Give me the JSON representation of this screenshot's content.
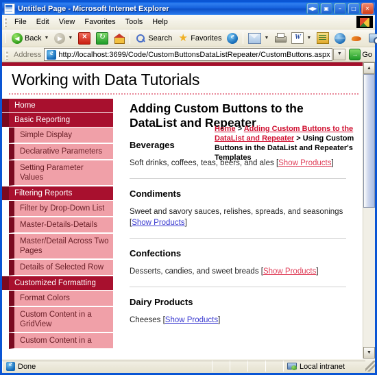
{
  "window": {
    "title": "Untitled Page - Microsoft Internet Explorer",
    "buttons": {
      "restore_group": "◀▶",
      "group2": "▣",
      "minimize": "–",
      "maximize": "□",
      "close": "✕"
    }
  },
  "menu": {
    "items": [
      {
        "label": "File"
      },
      {
        "label": "Edit"
      },
      {
        "label": "View"
      },
      {
        "label": "Favorites"
      },
      {
        "label": "Tools"
      },
      {
        "label": "Help"
      }
    ]
  },
  "toolbar": {
    "back_label": "Back",
    "forward_label": "",
    "search_label": "Search",
    "favorites_label": "Favorites",
    "caret": "▼"
  },
  "address": {
    "label": "Address",
    "url": "http://localhost:3699/Code/CustomButtonsDataListRepeater/CustomButtons.aspx",
    "dropdown": "▼",
    "go_label": "Go",
    "go_glyph": "→"
  },
  "site": {
    "title": "Working with Data Tutorials"
  },
  "breadcrumb": {
    "home": "Home",
    "sep1": " > ",
    "parent": "Adding Custom Buttons to the DataList and Repeater",
    "sep2": " > ",
    "current": "Using Custom Buttons in the DataList and Repeater's Templates"
  },
  "sidebar": {
    "items": [
      {
        "label": "Home",
        "type": "head"
      },
      {
        "label": "Basic Reporting",
        "type": "head"
      },
      {
        "label": "Simple Display",
        "type": "sub"
      },
      {
        "label": "Declarative Parameters",
        "type": "sub"
      },
      {
        "label": "Setting Parameter Values",
        "type": "sub"
      },
      {
        "label": "Filtering Reports",
        "type": "head"
      },
      {
        "label": "Filter by Drop-Down List",
        "type": "sub"
      },
      {
        "label": "Master-Details-Details",
        "type": "sub"
      },
      {
        "label": "Master/Detail Across Two Pages",
        "type": "sub"
      },
      {
        "label": "Details of Selected Row",
        "type": "sub"
      },
      {
        "label": "Customized Formatting",
        "type": "head"
      },
      {
        "label": "Format Colors",
        "type": "sub"
      },
      {
        "label": "Custom Content in a GridView",
        "type": "sub"
      },
      {
        "label": "Custom Content in a",
        "type": "sub"
      }
    ]
  },
  "main": {
    "heading": "Adding Custom Buttons to the DataList and Repeater",
    "link_label": "Show Products",
    "categories": [
      {
        "name": "Beverages",
        "description": "Soft drinks, coffees, teas, beers, and ales",
        "link_style": "red"
      },
      {
        "name": "Condiments",
        "description": "Sweet and savory sauces, relishes, spreads, and seasonings",
        "link_style": "blue"
      },
      {
        "name": "Confections",
        "description": "Desserts, candies, and sweet breads",
        "link_style": "red"
      },
      {
        "name": "Dairy Products",
        "description": "Cheeses",
        "link_style": "blue"
      }
    ]
  },
  "scrollbar": {
    "up": "▲",
    "down": "▼"
  },
  "status": {
    "document": "Done",
    "zone": "Local intranet"
  },
  "colors": {
    "brand_red": "#A40F2B",
    "nav_head": "#A8102E",
    "nav_sub": "#F0A0A8",
    "link_red": "#E0405A",
    "link_blue": "#3A3AD0"
  }
}
